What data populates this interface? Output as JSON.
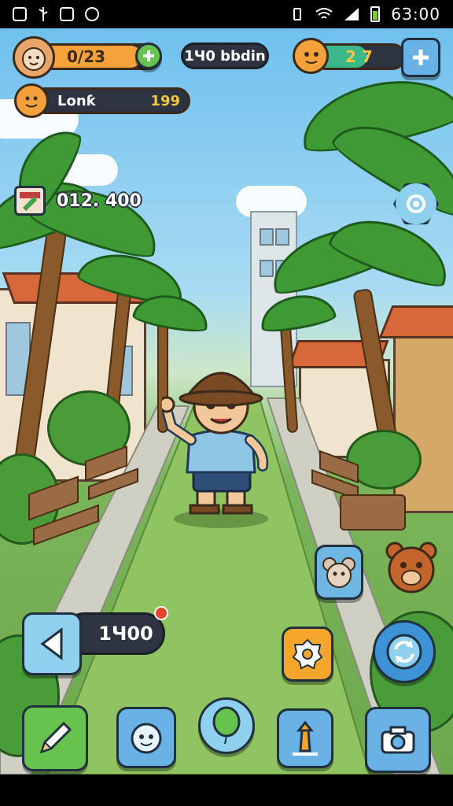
{
  "status_bar": {
    "time": "6З:00",
    "left_icons": [
      "gallery-icon",
      "usb-icon",
      "app-icon",
      "app-icon"
    ],
    "right_icons": [
      "vibrate-icon",
      "wifi-icon",
      "signal-icon",
      "battery-icon"
    ],
    "battery_level": 0.7
  },
  "hud": {
    "xp": {
      "text": "0/23",
      "level_fill": 0.85,
      "add_icon": "plus-icon"
    },
    "center_label": "1Ч0 bbdin",
    "energy": {
      "text": "2 7",
      "fill": 0.6,
      "add_icon": "plus-icon"
    },
    "player": {
      "name": "Lonƙ",
      "score": "199"
    },
    "timer": "012. 400",
    "distance": "1Ч00"
  },
  "buttons": {
    "back": "chevron-left-icon",
    "settings_gear": "gear-icon",
    "badge": "badge-icon",
    "refresh": "refresh-icon",
    "pencil": "pencil-icon",
    "companion": "face-icon",
    "balloon": "balloon-icon",
    "tower": "tower-icon",
    "camera": "camera-icon"
  },
  "colors": {
    "xp_bar": "#f6a23b",
    "energy_bar": "#3bb88a",
    "hud_dark": "#2d3340",
    "button_blue": "#69b2e6",
    "button_green": "#66c34d",
    "button_orange": "#f3a62b",
    "score_color": "#f4c542"
  }
}
